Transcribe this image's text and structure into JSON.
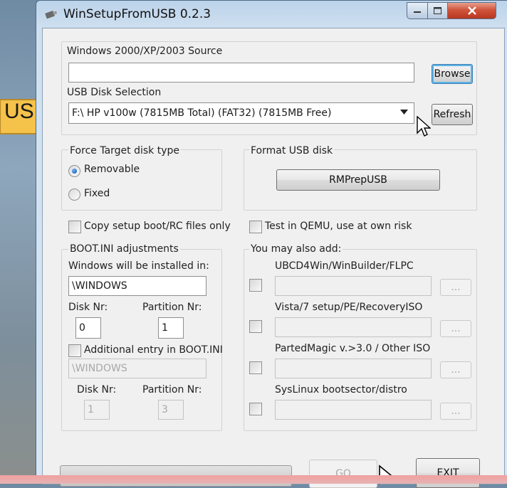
{
  "window": {
    "title": "WinSetupFromUSB 0.2.3",
    "icon": "usb-drive-icon"
  },
  "annotation": {
    "text": "USB",
    "icon": "arrow-right-icon",
    "color": "#f5c24a"
  },
  "source": {
    "label": "Windows 2000/XP/2003 Source",
    "value": "",
    "browse_label": "Browse"
  },
  "usb_disk": {
    "label": "USB Disk Selection",
    "selected": "F:\\ HP v100w (7815MB Total) (FAT32) (7815MB Free)",
    "refresh_label": "Refresh"
  },
  "force_target": {
    "label": "Force Target disk type",
    "options": [
      "Removable",
      "Fixed"
    ],
    "selected": "Removable"
  },
  "format": {
    "label": "Format USB disk",
    "button_label": "RMPrepUSB"
  },
  "copy_files_only": {
    "label": "Copy setup boot/RC files only",
    "checked": false
  },
  "test_qemu": {
    "label": "Test in QEMU, use at own risk",
    "checked": false
  },
  "boot_ini": {
    "label": "BOOT.INI adjustments",
    "install_label": "Windows will be installed in:",
    "install_value": "\\WINDOWS",
    "disk_label": "Disk Nr:",
    "disk_value": "0",
    "partition_label": "Partition Nr:",
    "partition_value": "1",
    "additional_label": "Additional entry in BOOT.INI",
    "additional_value": "\\WINDOWS",
    "additional_disk_label": "Disk Nr:",
    "additional_disk_value": "1",
    "additional_partition_label": "Partition Nr:",
    "additional_partition_value": "3"
  },
  "also_add": {
    "label": "You may also add:",
    "items": [
      {
        "label": "UBCD4Win/WinBuilder/FLPC",
        "value": "",
        "browse_label": "..."
      },
      {
        "label": "Vista/7 setup/PE/RecoveryISO",
        "value": "",
        "browse_label": "..."
      },
      {
        "label": "PartedMagic v.>3.0 / Other ISO",
        "value": "",
        "browse_label": "..."
      },
      {
        "label": "SysLinux bootsector/distro",
        "value": "",
        "browse_label": "..."
      }
    ]
  },
  "actions": {
    "go_label": "GO",
    "exit_label": "EXIT",
    "progress": 0
  },
  "colors": {
    "accent": "#5fb3e8",
    "close": "#d0543b"
  }
}
